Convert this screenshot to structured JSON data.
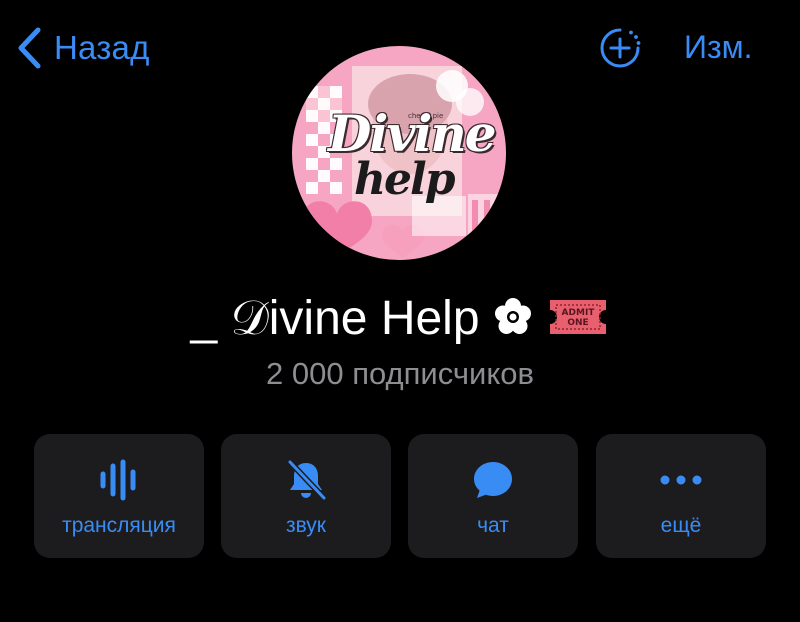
{
  "nav": {
    "back_label": "Назад",
    "edit_label": "Изм.",
    "back_icon": "chevron-left-icon",
    "add_icon": "add-circle-icon"
  },
  "avatar": {
    "small_label": "cherry pie",
    "word_1": "Divine",
    "word_2": "help",
    "colors": {
      "pink": "#f7a9c4",
      "light_pink": "#fcd3e0"
    }
  },
  "channel": {
    "title": "_ 𝒟ivine Help",
    "flower_icon": "flower-icon",
    "ticket_icon": "admit-one-ticket-icon",
    "ticket_text_line1": "ADMIT",
    "ticket_text_line2": "ONE",
    "subscribers": "2 000 подписчиков"
  },
  "actions": [
    {
      "label": "трансляция",
      "icon": "live-stream-waveform-icon"
    },
    {
      "label": "звук",
      "icon": "bell-muted-icon"
    },
    {
      "label": "чат",
      "icon": "chat-bubble-icon"
    },
    {
      "label": "ещё",
      "icon": "more-dots-icon"
    }
  ],
  "colors": {
    "background": "#000000",
    "accent": "#3a8cf5",
    "button_bg": "#1c1c1e",
    "secondary_text": "#8d8d92",
    "ticket": "#e8606e"
  }
}
